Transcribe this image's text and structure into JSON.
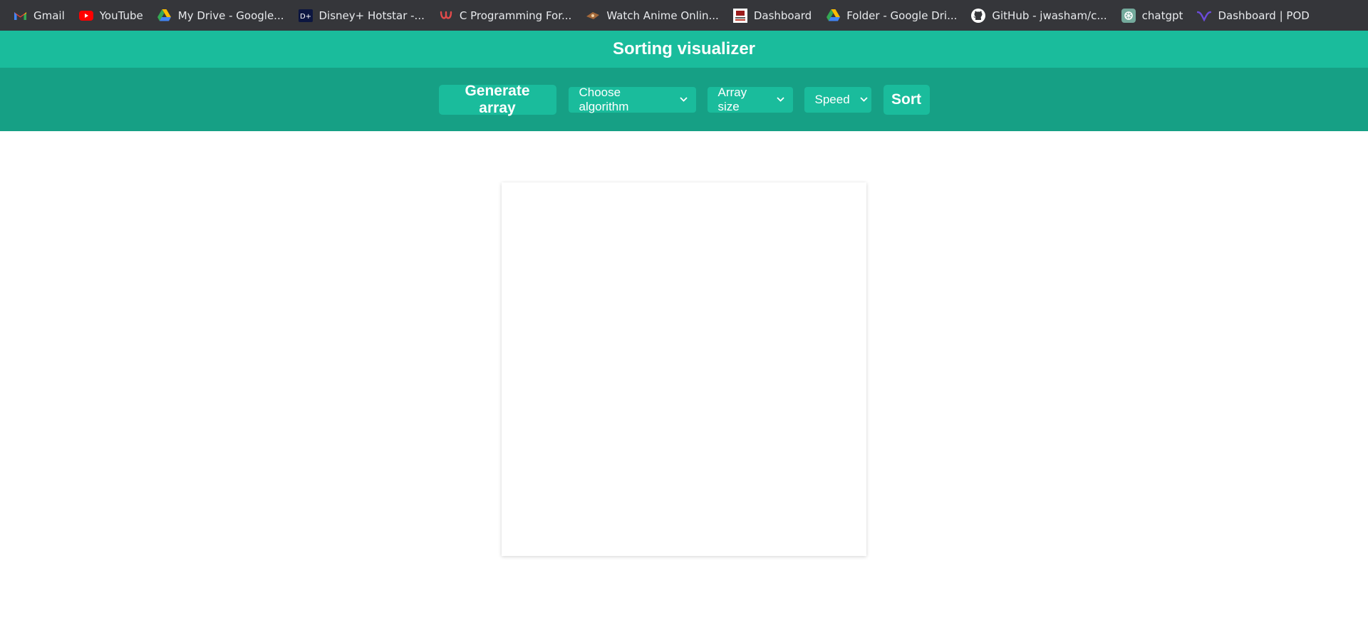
{
  "bookmarks": [
    {
      "label": "Gmail",
      "icon": "gmail-icon"
    },
    {
      "label": "YouTube",
      "icon": "youtube-icon"
    },
    {
      "label": "My Drive - Google...",
      "icon": "google-drive-icon"
    },
    {
      "label": "Disney+ Hotstar -...",
      "icon": "hotstar-icon"
    },
    {
      "label": "C Programming For...",
      "icon": "udemy-icon"
    },
    {
      "label": "Watch Anime Onlin...",
      "icon": "anime-site-icon"
    },
    {
      "label": "Dashboard",
      "icon": "dashboard-site-icon"
    },
    {
      "label": "Folder - Google Dri...",
      "icon": "google-drive-icon"
    },
    {
      "label": "GitHub - jwasham/c...",
      "icon": "github-icon"
    },
    {
      "label": "chatgpt",
      "icon": "chatgpt-icon"
    },
    {
      "label": "Dashboard | POD",
      "icon": "pod-icon"
    }
  ],
  "header": {
    "title": "Sorting visualizer"
  },
  "toolbar": {
    "generate_label": "Generate array",
    "algorithm_selected": "Choose algorithm",
    "size_selected": "Array size",
    "speed_selected": "Speed",
    "sort_label": "Sort"
  },
  "colors": {
    "header_bg": "#1abc9c",
    "toolbar_bg": "#16a085",
    "button_bg": "#1abc9c",
    "bookmarks_bg": "#35363a"
  }
}
